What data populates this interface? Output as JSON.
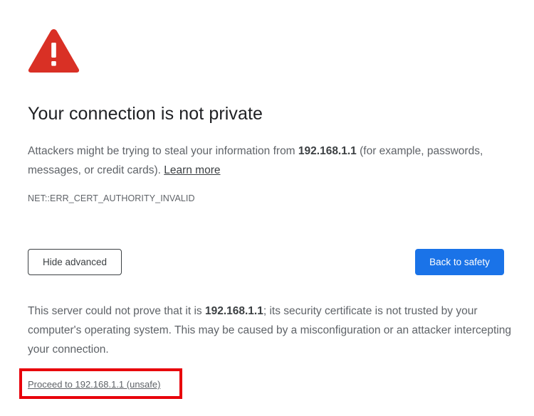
{
  "icons": {
    "warning": "warning-triangle-icon"
  },
  "colors": {
    "warning_red": "#d93025",
    "primary_blue": "#1a73e8",
    "highlight_red": "#e8000b"
  },
  "page": {
    "title": "Your connection is not private",
    "message_pre": "Attackers might be trying to steal your information from ",
    "host": "192.168.1.1",
    "message_post": " (for example, passwords, messages, or credit cards). ",
    "learn_more": "Learn more",
    "error_code": "NET::ERR_CERT_AUTHORITY_INVALID"
  },
  "buttons": {
    "hide_advanced": "Hide advanced",
    "back_to_safety": "Back to safety"
  },
  "details": {
    "pre": "This server could not prove that it is ",
    "host": "192.168.1.1",
    "post": "; its security certificate is not trusted by your computer's operating system. This may be caused by a misconfiguration or an attacker intercepting your connection.",
    "proceed_link": "Proceed to 192.168.1.1 (unsafe)"
  }
}
